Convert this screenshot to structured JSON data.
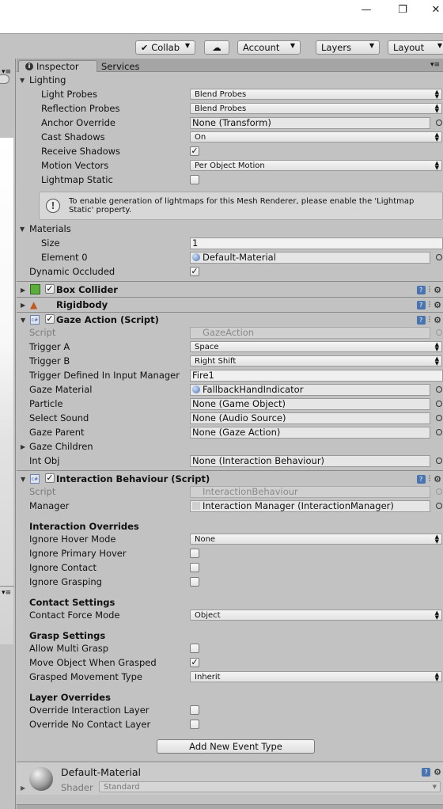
{
  "window": {
    "minimize": "—",
    "restore": "❐",
    "close": "✕"
  },
  "toolbar": {
    "collab": "Collab",
    "cloud": "☁",
    "account": "Account",
    "layers": "Layers",
    "layout": "Layout"
  },
  "tabs": {
    "inspector": "Inspector",
    "services": "Services"
  },
  "lighting": {
    "title": "Lighting",
    "light_probes_label": "Light Probes",
    "light_probes_value": "Blend Probes",
    "reflection_probes_label": "Reflection Probes",
    "reflection_probes_value": "Blend Probes",
    "anchor_override_label": "Anchor Override",
    "anchor_override_value": "None (Transform)",
    "cast_shadows_label": "Cast Shadows",
    "cast_shadows_value": "On",
    "receive_shadows_label": "Receive Shadows",
    "motion_vectors_label": "Motion Vectors",
    "motion_vectors_value": "Per Object Motion",
    "lightmap_static_label": "Lightmap Static",
    "help_text": "To enable generation of lightmaps for this Mesh Renderer, please enable the 'Lightmap Static' property."
  },
  "materials": {
    "title": "Materials",
    "size_label": "Size",
    "size_value": "1",
    "element0_label": "Element 0",
    "element0_value": "Default-Material",
    "dynamic_occluded_label": "Dynamic Occluded"
  },
  "components": {
    "box_collider": "Box Collider",
    "rigidbody": "Rigidbody",
    "gaze_action": "Gaze Action (Script)",
    "interaction_behaviour": "Interaction Behaviour (Script)"
  },
  "gaze": {
    "script_label": "Script",
    "script_value": "GazeAction",
    "trigger_a_label": "Trigger A",
    "trigger_a_value": "Space",
    "trigger_b_label": "Trigger B",
    "trigger_b_value": "Right Shift",
    "trigger_input_label": "Trigger Defined In Input Manager",
    "trigger_input_value": "Fire1",
    "gaze_material_label": "Gaze Material",
    "gaze_material_value": "FallbackHandIndicator",
    "particle_label": "Particle",
    "particle_value": "None (Game Object)",
    "select_sound_label": "Select Sound",
    "select_sound_value": "None (Audio Source)",
    "gaze_parent_label": "Gaze Parent",
    "gaze_parent_value": "None (Gaze Action)",
    "gaze_children_label": "Gaze Children",
    "int_obj_label": "Int Obj",
    "int_obj_value": "None (Interaction Behaviour)"
  },
  "interaction": {
    "script_label": "Script",
    "script_value": "InteractionBehaviour",
    "manager_label": "Manager",
    "manager_value": "Interaction Manager (InteractionManager)",
    "overrides_header": "Interaction Overrides",
    "ignore_hover_mode_label": "Ignore Hover Mode",
    "ignore_hover_mode_value": "None",
    "ignore_primary_hover_label": "Ignore Primary Hover",
    "ignore_contact_label": "Ignore Contact",
    "ignore_grasping_label": "Ignore Grasping",
    "contact_header": "Contact Settings",
    "contact_force_mode_label": "Contact Force Mode",
    "contact_force_mode_value": "Object",
    "grasp_header": "Grasp Settings",
    "allow_multi_grasp_label": "Allow Multi Grasp",
    "move_object_label": "Move Object When Grasped",
    "grasped_movement_label": "Grasped Movement Type",
    "grasped_movement_value": "Inherit",
    "layer_header": "Layer Overrides",
    "override_interaction_label": "Override Interaction Layer",
    "override_no_contact_label": "Override No Contact Layer",
    "add_event_button": "Add New Event Type"
  },
  "material_footer": {
    "name": "Default-Material",
    "shader_label": "Shader",
    "shader_value": "Standard"
  }
}
